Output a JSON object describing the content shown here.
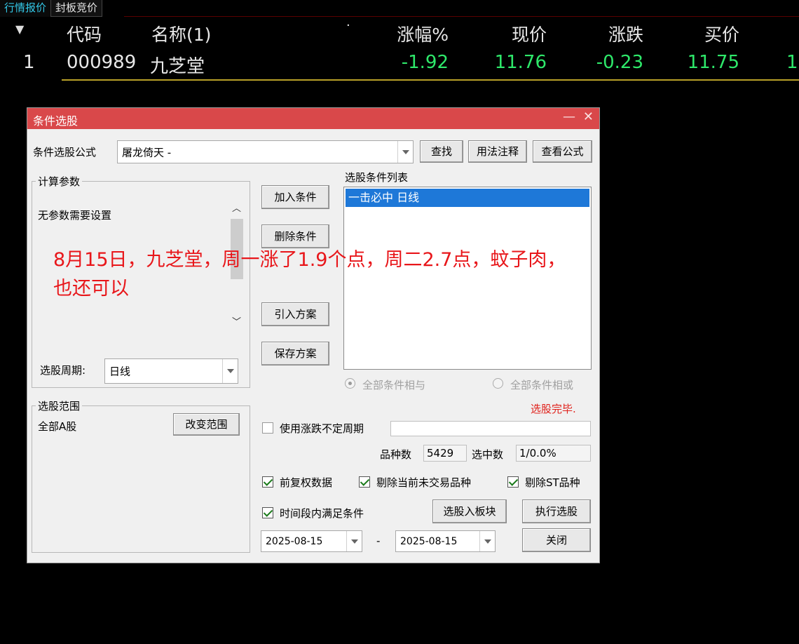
{
  "tabs": [
    "行情报价",
    "封板竞价"
  ],
  "quote_header": {
    "code": "代码",
    "name": "名称(1)",
    "dot": "·",
    "change_pct": "涨幅%",
    "price": "现价",
    "change": "涨跌",
    "bid": "买价"
  },
  "quote_row": {
    "index": "1",
    "code": "000989",
    "name": "九芝堂",
    "change_pct": "-1.92",
    "price": "11.76",
    "change": "-0.23",
    "bid": "11.75",
    "next_col_partial": "1"
  },
  "dialog": {
    "title": "条件选股",
    "formula_label": "条件选股公式",
    "formula_value": "屠龙倚天  -",
    "btn_find": "查找",
    "btn_usage": "用法注释",
    "btn_view": "查看公式",
    "params_group": "计算参数",
    "params_text": "无参数需要设置",
    "period_label": "选股周期:",
    "period_value": "日线",
    "btn_add": "加入条件",
    "btn_delete": "删除条件",
    "btn_import": "引入方案",
    "btn_save": "保存方案",
    "list_label": "选股条件列表",
    "list_items": [
      "一击必中  日线"
    ],
    "radio_and": "全部条件相与",
    "radio_or": "全部条件相或",
    "status": "选股完毕.",
    "range_group": "选股范围",
    "range_value": "全部A股",
    "btn_change_range": "改变范围",
    "use_period_label": "使用涨跌不定周期",
    "count_label": "品种数",
    "count_value": "5429",
    "selected_label": "选中数",
    "selected_value": "1/0.0%",
    "cb_prior": "前复权数据",
    "cb_exclude_suspended": "剔除当前未交易品种",
    "cb_exclude_st": "剔除ST品种",
    "cb_time_range": "时间段内满足条件",
    "btn_to_block": "选股入板块",
    "btn_execute": "执行选股",
    "date_from": "2025-08-15",
    "date_sep": "-",
    "date_to": "2025-08-15",
    "btn_close": "关闭"
  },
  "overlay": {
    "line1": "8月15日，九芝堂，周一涨了1.9个点，周二2.7点，蚊子肉，",
    "line2": "也还可以"
  },
  "colors": {
    "accent_red": "#d9484a",
    "up_green": "#2ee86a",
    "list_select": "#1e78d8",
    "annotation": "#e8161a"
  }
}
